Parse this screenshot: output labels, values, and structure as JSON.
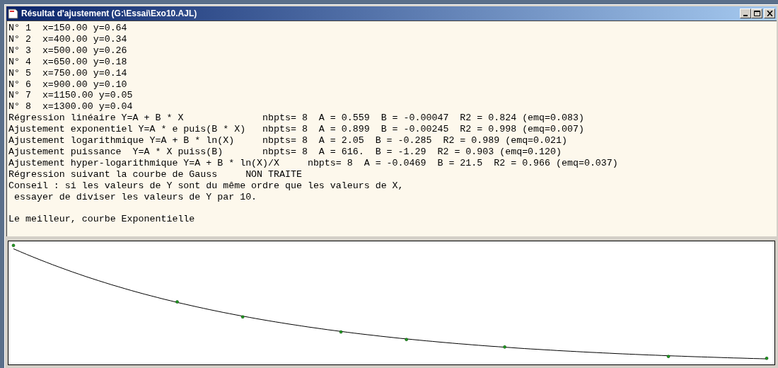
{
  "window": {
    "title": "Résultat d'ajustement (G:\\Essai\\Exo10.AJL)"
  },
  "paragraphs": [
    [
      "N° 1  x=150.00 y=0.64",
      "N° 2  x=400.00 y=0.34",
      "N° 3  x=500.00 y=0.26",
      "N° 4  x=650.00 y=0.18",
      "N° 5  x=750.00 y=0.14",
      "N° 6  x=900.00 y=0.10",
      "N° 7  x=1150.00 y=0.05",
      "N° 8  x=1300.00 y=0.04",
      "Régression linéaire Y=A + B * X              nbpts= 8  A = 0.559  B = -0.00047  R2 = 0.824 (emq=0.083)",
      "Ajustement exponentiel Y=A * e puis(B * X)   nbpts= 8  A = 0.899  B = -0.00245  R2 = 0.998 (emq=0.007)",
      "Ajustement logarithmique Y=A + B * ln(X)     nbpts= 8  A = 2.05  B = -0.285  R2 = 0.989 (emq=0.021)",
      "Ajustement puissance  Y=A * X puiss(B)       nbpts= 8  A = 616.  B = -1.29  R2 = 0.903 (emq=0.120)",
      "Ajustement hyper-logarithmique Y=A + B * ln(X)/X     nbpts= 8  A = -0.0469  B = 21.5  R2 = 0.966 (emq=0.037)",
      "Régression suivant la courbe de Gauss     NON TRAITE",
      "Conseil : si les valeurs de Y sont du même ordre que les valeurs de X,",
      " essayer de diviser les valeurs de Y par 10."
    ],
    [
      "Le meilleur, courbe Exponentielle"
    ]
  ]
}
